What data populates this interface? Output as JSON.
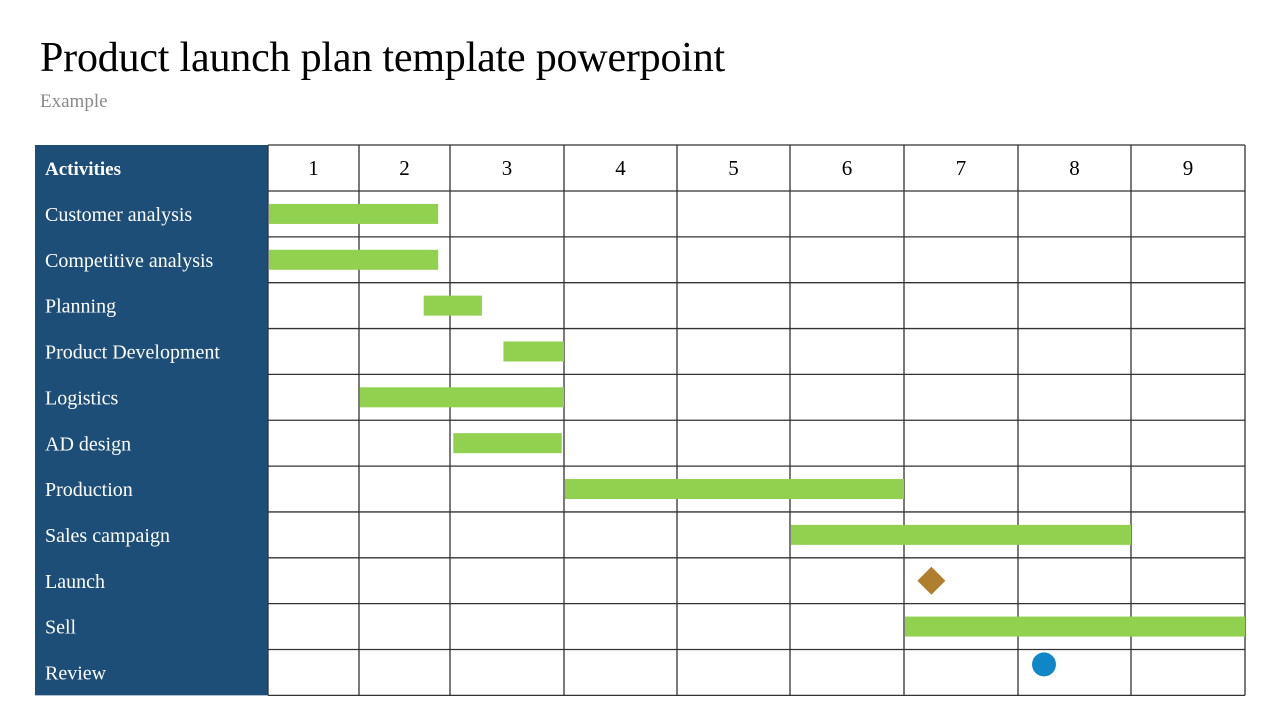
{
  "header": {
    "title": "Product launch plan template powerpoint",
    "subtitle": "Example"
  },
  "colors": {
    "label_panel": "#1d4e78",
    "bar": "#92d050",
    "milestone_diamond": "#b07f2e",
    "milestone_circle": "#0f86c6",
    "grid": "#333333"
  },
  "chart_data": {
    "type": "gantt",
    "title": "Product launch plan template powerpoint",
    "subtitle": "Example",
    "column_header": "Activities",
    "periods": [
      "1",
      "2",
      "3",
      "4",
      "5",
      "6",
      "7",
      "8",
      "9"
    ],
    "x_range": [
      0,
      9
    ],
    "grid": true,
    "tasks": [
      {
        "name": "Customer analysis",
        "kind": "bar",
        "start": 0.0,
        "end": 1.87
      },
      {
        "name": "Competitive analysis",
        "kind": "bar",
        "start": 0.0,
        "end": 1.87
      },
      {
        "name": "Planning",
        "kind": "bar",
        "start": 1.7,
        "end": 2.28
      },
      {
        "name": "Product Development",
        "kind": "bar",
        "start": 2.46,
        "end": 3.0
      },
      {
        "name": "Logistics",
        "kind": "bar",
        "start": 1.0,
        "end": 3.0
      },
      {
        "name": "AD design",
        "kind": "bar",
        "start": 2.02,
        "end": 2.98
      },
      {
        "name": "Production",
        "kind": "bar",
        "start": 3.0,
        "end": 6.0
      },
      {
        "name": "Sales campaign",
        "kind": "bar",
        "start": 5.0,
        "end": 8.0
      },
      {
        "name": "Launch",
        "kind": "milestone-diamond",
        "at": 6.24
      },
      {
        "name": "Sell",
        "kind": "bar",
        "start": 6.0,
        "end": 9.0
      },
      {
        "name": "Review",
        "kind": "milestone-circle",
        "at": 7.23
      }
    ]
  }
}
